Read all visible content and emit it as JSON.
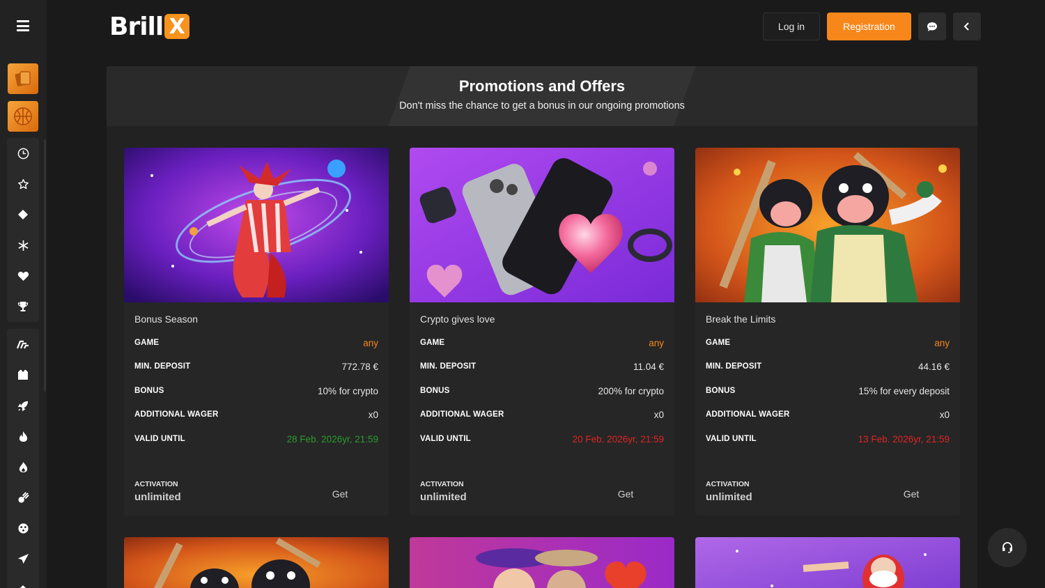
{
  "header": {
    "logo_text": "Brill",
    "logo_x": "X",
    "login_label": "Log in",
    "registration_label": "Registration"
  },
  "sidebar": {
    "group1_icons": [
      "clock-icon",
      "star-icon",
      "diamond-icon",
      "snowflake-icon",
      "heart-icon",
      "trophy-icon"
    ],
    "group2_icons": [
      "speed-icon",
      "shirt-icon",
      "rocket-icon",
      "fire-icon",
      "flame-icon",
      "comet-icon",
      "dice-icon",
      "plane-icon"
    ]
  },
  "banner": {
    "title": "Promotions and Offers",
    "subtitle": "Don't miss the chance to get a bonus in our ongoing promotions"
  },
  "cards": [
    {
      "title": "Bonus Season",
      "game_label": "GAME",
      "game_value": "any",
      "min_deposit_label": "MIN. DEPOSIT",
      "min_deposit_value": "772.78 €",
      "bonus_label": "BONUS",
      "bonus_value": "10% for crypto",
      "wager_label": "ADDITIONAL WAGER",
      "wager_value": "x0",
      "valid_label": "VALID UNTIL",
      "valid_value": "28 Feb. 2026yr, 21:59",
      "activation_label": "ACTIVATION",
      "activation_value": "unlimited",
      "get_label": "Get"
    },
    {
      "title": "Crypto gives love",
      "game_label": "GAME",
      "game_value": "any",
      "min_deposit_label": "MIN. DEPOSIT",
      "min_deposit_value": "11.04 €",
      "bonus_label": "BONUS",
      "bonus_value": "200% for crypto",
      "wager_label": "ADDITIONAL WAGER",
      "wager_value": "x0",
      "valid_label": "VALID UNTIL",
      "valid_value": "20 Feb. 2026yr, 21:59",
      "activation_label": "ACTIVATION",
      "activation_value": "unlimited",
      "get_label": "Get"
    },
    {
      "title": "Break the Limits",
      "game_label": "GAME",
      "game_value": "any",
      "min_deposit_label": "MIN. DEPOSIT",
      "min_deposit_value": "44.16 €",
      "bonus_label": "BONUS",
      "bonus_value": "15% for every deposit",
      "wager_label": "ADDITIONAL WAGER",
      "wager_value": "x0",
      "valid_label": "VALID UNTIL",
      "valid_value": "13 Feb. 2026yr, 21:59",
      "activation_label": "ACTIVATION",
      "activation_value": "unlimited",
      "get_label": "Get"
    }
  ],
  "colors": {
    "accent": "#f7871a",
    "valid_green": "#2a9d2e",
    "valid_red": "#e02424"
  }
}
